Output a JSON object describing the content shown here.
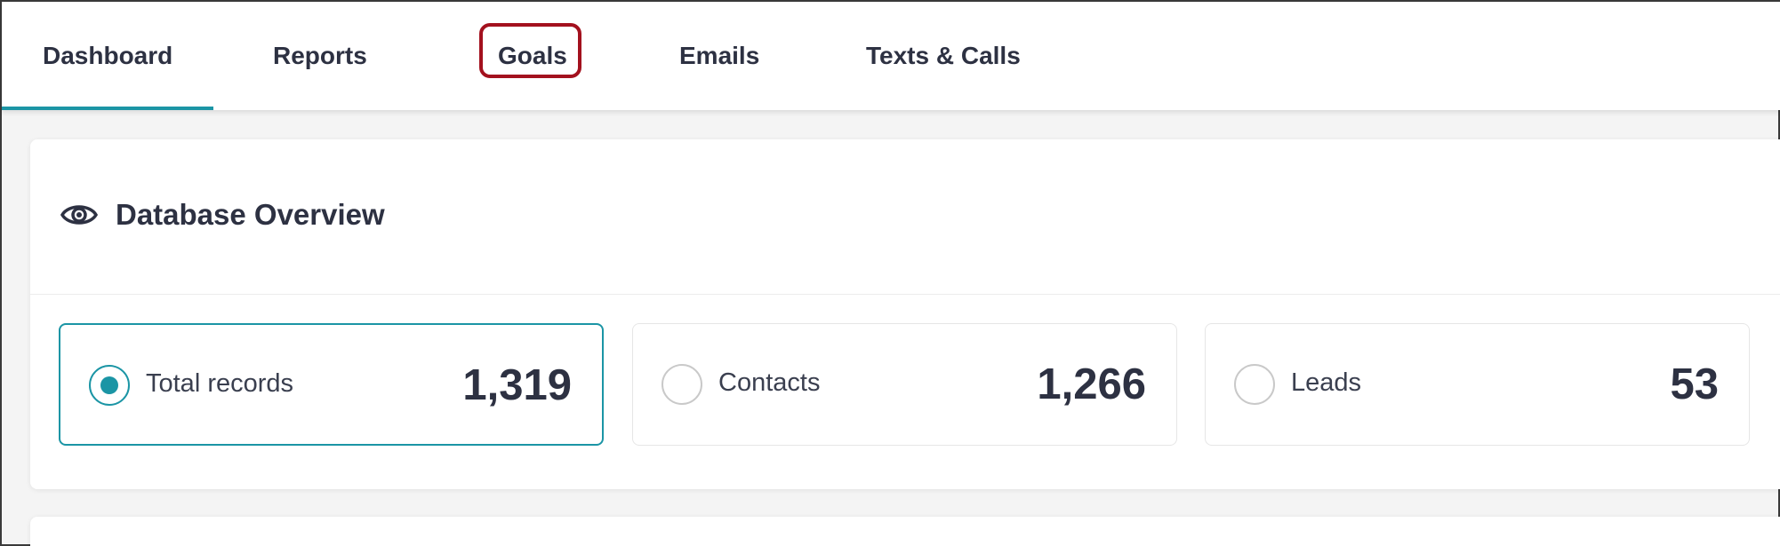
{
  "nav": {
    "tabs": [
      {
        "label": "Dashboard",
        "active": true
      },
      {
        "label": "Reports",
        "active": false
      },
      {
        "label": "Goals",
        "active": false,
        "highlighted": true
      },
      {
        "label": "Emails",
        "active": false
      },
      {
        "label": "Texts & Calls",
        "active": false
      }
    ]
  },
  "overview": {
    "icon": "eye-icon",
    "title": "Database Overview",
    "stats": [
      {
        "label": "Total records",
        "value": "1,319",
        "selected": true
      },
      {
        "label": "Contacts",
        "value": "1,266",
        "selected": false
      },
      {
        "label": "Leads",
        "value": "53",
        "selected": false
      }
    ]
  },
  "colors": {
    "accent": "#1b95a5",
    "highlight": "#a3111e",
    "text": "#2d3142"
  }
}
